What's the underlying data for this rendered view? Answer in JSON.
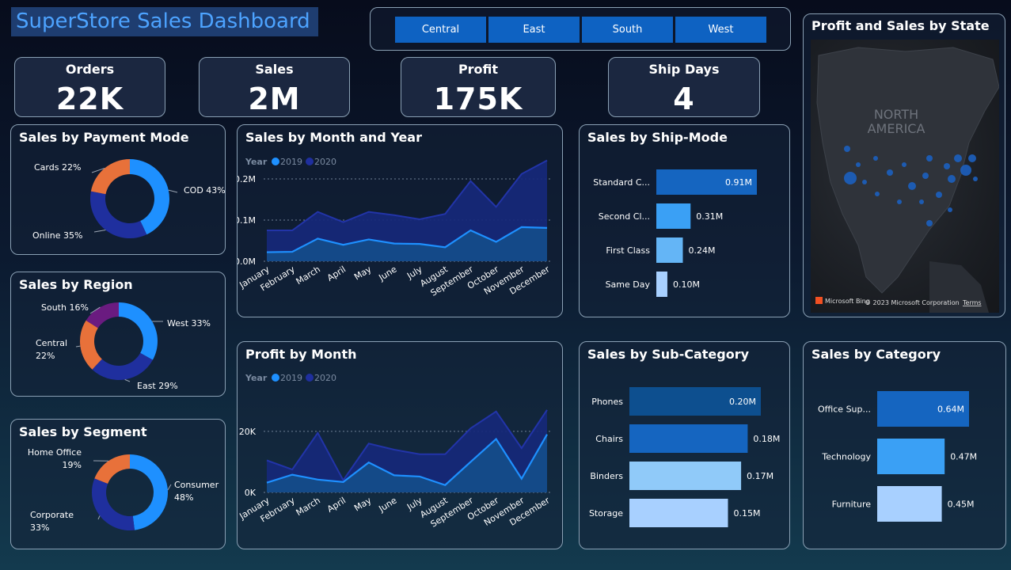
{
  "title": "SuperStore Sales Dashboard",
  "slicer": {
    "options": [
      "Central",
      "East",
      "South",
      "West"
    ]
  },
  "kpis": [
    {
      "label": "Orders",
      "value": "22K"
    },
    {
      "label": "Sales",
      "value": "2M"
    },
    {
      "label": "Profit",
      "value": "175K"
    },
    {
      "label": "Ship Days",
      "value": "4"
    }
  ],
  "map": {
    "title": "Profit and Sales by State",
    "region_label_1": "NORTH",
    "region_label_2": "AMERICA",
    "brand": "Microsoft Bing",
    "copyright": "© 2023 Microsoft Corporation",
    "terms": "Terms"
  },
  "legend": {
    "title": "Year",
    "y2019": "2019",
    "y2020": "2020"
  },
  "colors": {
    "c2019": "#1e90ff",
    "c2020": "#1f2f9e",
    "c_light": "#a8d0ff",
    "c_mid": "#3aa0f5",
    "c_dark": "#1565c0",
    "c_orange": "#e8713a",
    "c_purple": "#6a1b80"
  },
  "chart_data": [
    {
      "type": "pie",
      "title": "Sales by Payment Mode",
      "slices": [
        {
          "label": "COD",
          "value": 43,
          "text": "COD 43%"
        },
        {
          "label": "Online",
          "value": 35,
          "text": "Online 35%"
        },
        {
          "label": "Cards",
          "value": 22,
          "text": "Cards 22%"
        }
      ]
    },
    {
      "type": "pie",
      "title": "Sales by Region",
      "slices": [
        {
          "label": "West",
          "value": 33,
          "text": "West 33%"
        },
        {
          "label": "East",
          "value": 29,
          "text": "East 29%"
        },
        {
          "label": "Central",
          "value": 22,
          "text1": "Central",
          "text2": "22%"
        },
        {
          "label": "South",
          "value": 16,
          "text": "South 16%"
        }
      ]
    },
    {
      "type": "pie",
      "title": "Sales by Segment",
      "slices": [
        {
          "label": "Consumer",
          "value": 48,
          "text1": "Consumer",
          "text2": "48%"
        },
        {
          "label": "Corporate",
          "value": 33,
          "text1": "Corporate",
          "text2": "33%"
        },
        {
          "label": "Home Office",
          "value": 19,
          "text1": "Home Office",
          "text2": "19%"
        }
      ]
    },
    {
      "type": "area",
      "title": "Sales by Month and Year",
      "categories": [
        "January",
        "February",
        "March",
        "April",
        "May",
        "June",
        "July",
        "August",
        "September",
        "October",
        "November",
        "December"
      ],
      "series": [
        {
          "name": "2019",
          "values": [
            0.022,
            0.023,
            0.055,
            0.04,
            0.053,
            0.043,
            0.042,
            0.034,
            0.075,
            0.047,
            0.083,
            0.081
          ]
        },
        {
          "name": "2020",
          "values": [
            0.075,
            0.075,
            0.12,
            0.095,
            0.12,
            0.112,
            0.102,
            0.115,
            0.195,
            0.132,
            0.212,
            0.245
          ]
        }
      ],
      "yticks": [
        "0.0M",
        "0.1M",
        "0.2M"
      ],
      "ylim": [
        0,
        0.25
      ]
    },
    {
      "type": "area",
      "title": "Profit by Month",
      "categories": [
        "January",
        "February",
        "March",
        "April",
        "May",
        "June",
        "July",
        "August",
        "September",
        "October",
        "November",
        "December"
      ],
      "series": [
        {
          "name": "2019",
          "values": [
            3200,
            5800,
            4200,
            3400,
            9800,
            5600,
            5200,
            2400,
            10000,
            17500,
            4500,
            19000
          ]
        },
        {
          "name": "2020",
          "values": [
            10500,
            7500,
            19500,
            4000,
            16000,
            14000,
            12500,
            12500,
            21000,
            26500,
            14500,
            27000
          ]
        }
      ],
      "yticks": [
        "0K",
        "20K"
      ],
      "ylim": [
        0,
        28000
      ]
    },
    {
      "type": "bar",
      "title": "Sales by Ship-Mode",
      "categories": [
        "Standard C...",
        "Second Cl...",
        "First Class",
        "Same Day"
      ],
      "values": [
        0.91,
        0.31,
        0.24,
        0.1
      ],
      "labels": [
        "0.91M",
        "0.31M",
        "0.24M",
        "0.10M"
      ]
    },
    {
      "type": "bar",
      "title": "Sales by Sub-Category",
      "categories": [
        "Phones",
        "Chairs",
        "Binders",
        "Storage"
      ],
      "values": [
        0.2,
        0.18,
        0.17,
        0.15
      ],
      "labels": [
        "0.20M",
        "0.18M",
        "0.17M",
        "0.15M"
      ]
    },
    {
      "type": "bar",
      "title": "Sales by Category",
      "categories": [
        "Office Sup...",
        "Technology",
        "Furniture"
      ],
      "values": [
        0.64,
        0.47,
        0.45
      ],
      "labels": [
        "0.64M",
        "0.47M",
        "0.45M"
      ]
    }
  ]
}
